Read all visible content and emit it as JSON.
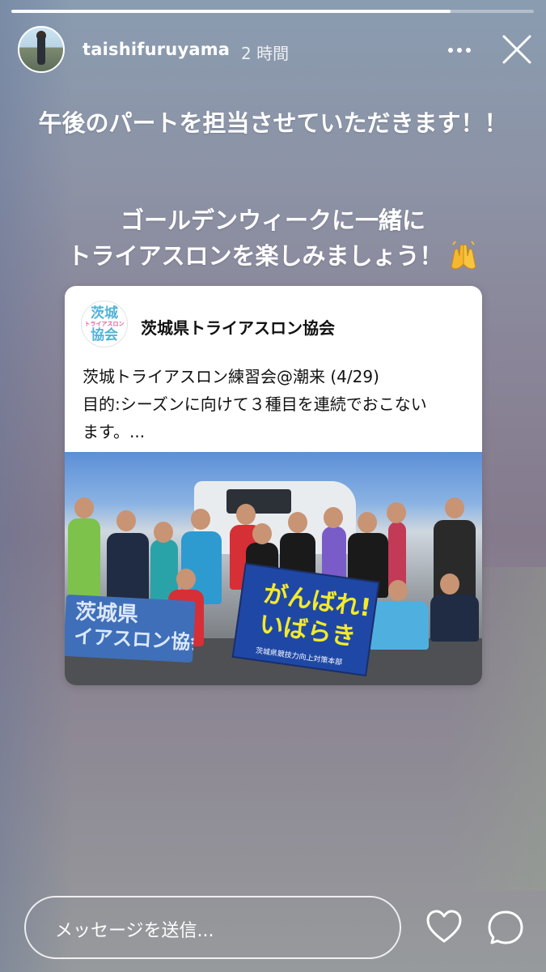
{
  "story": {
    "progress": 0.84,
    "username": "taishifuruyama",
    "timestamp": "2 時間",
    "avatar_icon": "profile-avatar",
    "more_icon": "more-dots-icon",
    "close_icon": "close-x-icon",
    "text_line1": "午後のパートを担当させていただきます！！",
    "text_line2a": "ゴールデンウィークに一緒に",
    "text_line2b": "トライアスロンを楽しみましょう！",
    "emoji": "raising-hands-emoji"
  },
  "shared_post": {
    "account_name": "茨城県トライアスロン協会",
    "avatar_logo_line1": "茨城",
    "avatar_logo_line2": "トライアスロン",
    "avatar_logo_line3": "協会",
    "caption_line1": "茨城トライアスロン練習会@潮来 (4/29)",
    "caption_line2": "目的:シーズンに向けて３種目を連続でおこない",
    "caption_line3": "ます。...",
    "photo": {
      "banner_left_line1": "茨城県",
      "banner_left_line2": "イアスロン協会",
      "banner_right_line1": "がんばれ!",
      "banner_right_line2": "いばらき",
      "banner_right_footer": "茨城県競技力向上対策本部"
    }
  },
  "reply": {
    "placeholder": "メッセージを送信...",
    "heart_icon": "heart-icon",
    "send_icon": "send-message-icon"
  },
  "colors": {
    "text": "#ffffff",
    "card_bg": "#ffffff",
    "banner_blue": "#1f48a6",
    "banner_yellow": "#f4ea2a"
  }
}
